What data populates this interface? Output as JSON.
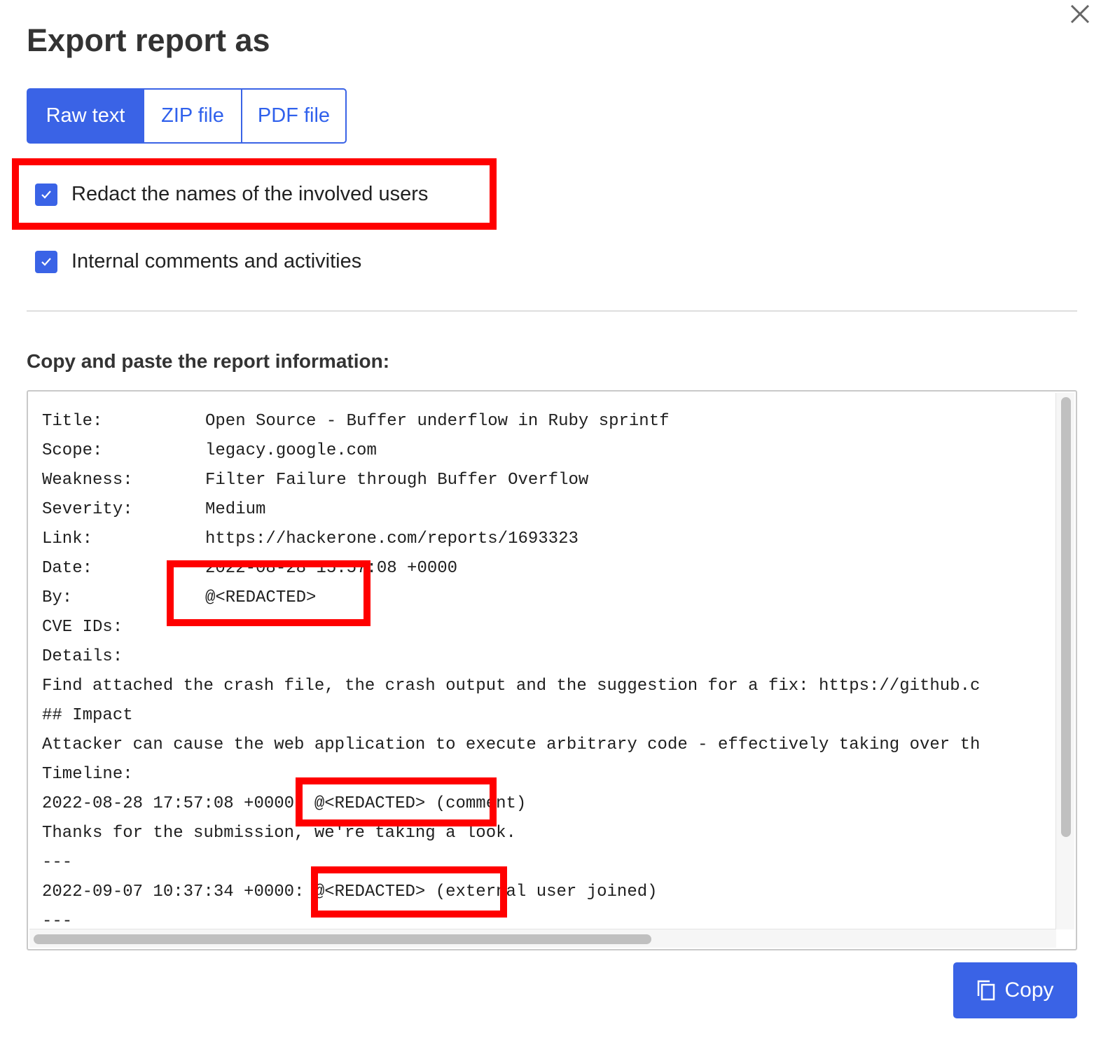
{
  "dialog": {
    "title": "Export report as",
    "close_icon": "close-icon"
  },
  "format_tabs": [
    {
      "label": "Raw text",
      "active": true
    },
    {
      "label": "ZIP file",
      "active": false
    },
    {
      "label": "PDF file",
      "active": false
    }
  ],
  "options": [
    {
      "label": "Redact the names of the involved users",
      "checked": true
    },
    {
      "label": "Internal comments and activities",
      "checked": true
    }
  ],
  "report": {
    "section_title": "Copy and paste the report information:",
    "fields": [
      {
        "label": "Title:",
        "value": "Open Source - Buffer underflow in Ruby sprintf"
      },
      {
        "label": "Scope:",
        "value": "legacy.google.com"
      },
      {
        "label": "Weakness:",
        "value": "Filter Failure through Buffer Overflow"
      },
      {
        "label": "Severity:",
        "value": "Medium"
      },
      {
        "label": "Link:",
        "value": "https://hackerone.com/reports/1693323"
      },
      {
        "label": "Date:",
        "value": "2022-08-28 15:57:08 +0000"
      },
      {
        "label": "By:",
        "value": "@<REDACTED>"
      },
      {
        "label": "CVE IDs:",
        "value": ""
      },
      {
        "label": "Details:",
        "value": ""
      }
    ],
    "details_lines": [
      "Find attached the crash file, the crash output and the suggestion for a fix: https://github.c",
      "## Impact",
      "Attacker can cause the web application to execute arbitrary code - effectively taking over th",
      "Timeline:",
      "2022-08-28 17:57:08 +0000: @<REDACTED> (comment)",
      "Thanks for the submission, we're taking a look.",
      "---",
      "2022-09-07 10:37:34 +0000: @<REDACTED> (external user joined)",
      "---"
    ]
  },
  "copy_button": {
    "label": "Copy",
    "icon": "copy-icon"
  },
  "colors": {
    "primary": "#3a63e6",
    "highlight": "#ff0000",
    "text": "#2b2b2b"
  }
}
